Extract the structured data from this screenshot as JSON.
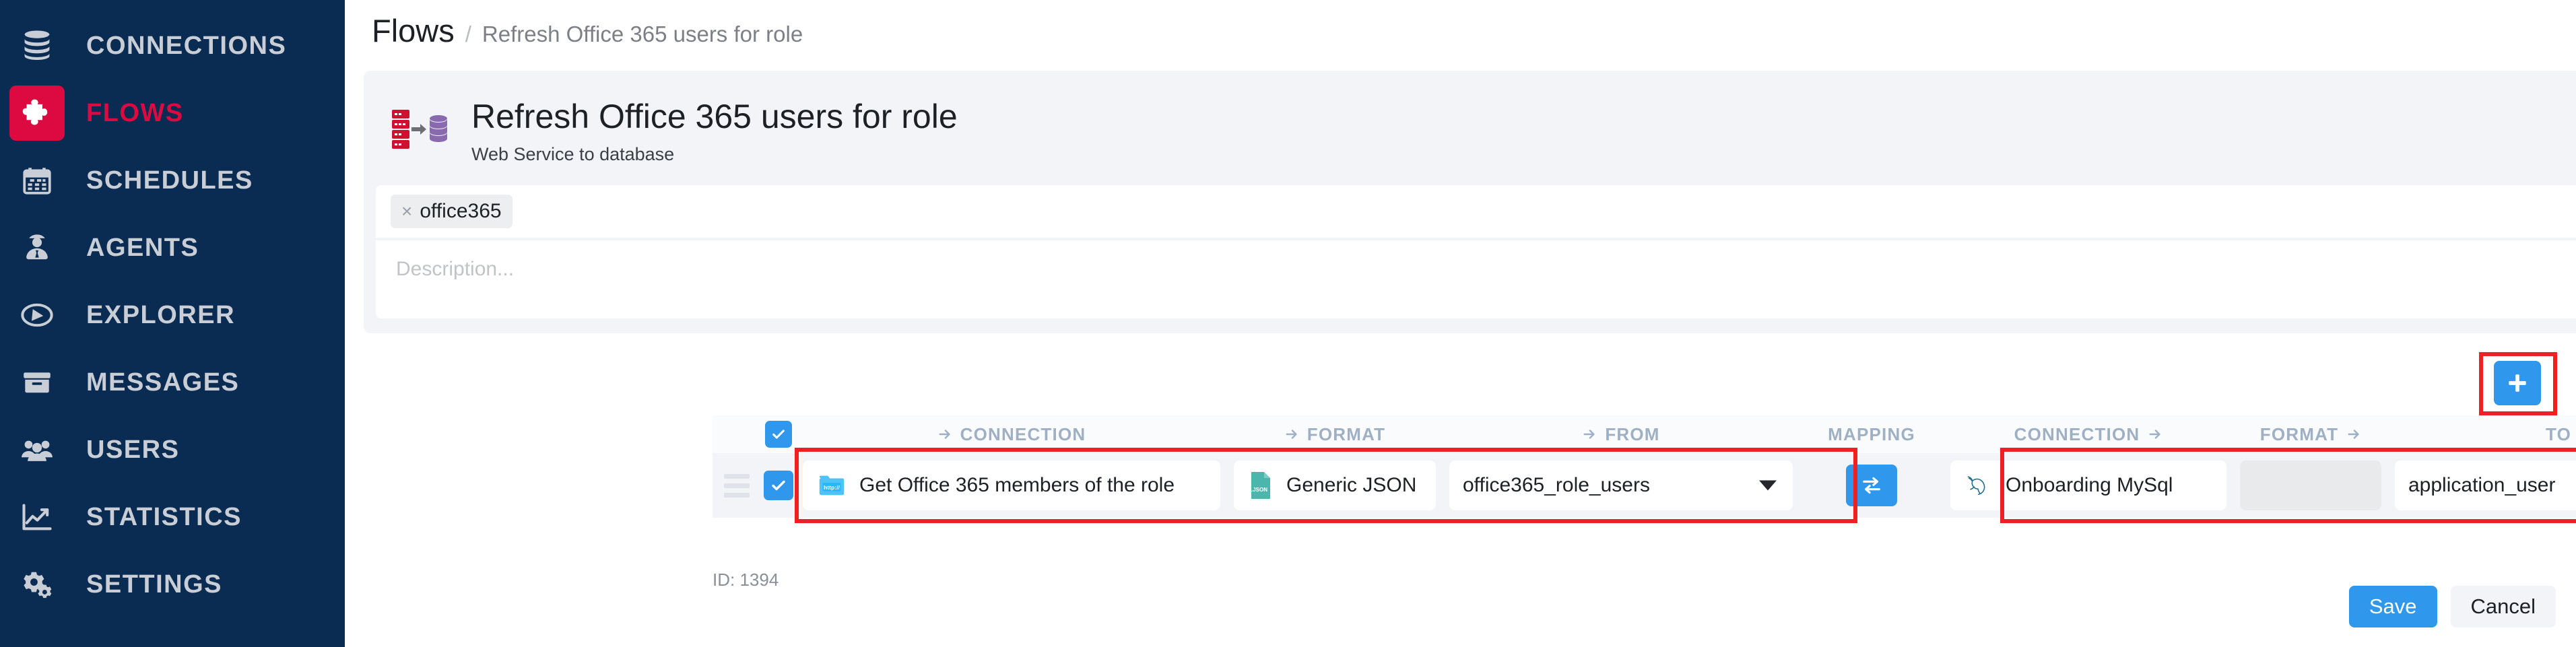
{
  "sidebar": {
    "items": [
      {
        "label": "CONNECTIONS",
        "icon": "database-stack-icon",
        "active": false
      },
      {
        "label": "FLOWS",
        "icon": "puzzle-piece-icon",
        "active": true
      },
      {
        "label": "SCHEDULES",
        "icon": "calendar-icon",
        "active": false
      },
      {
        "label": "AGENTS",
        "icon": "agent-icon",
        "active": false
      },
      {
        "label": "EXPLORER",
        "icon": "compass-icon",
        "active": false
      },
      {
        "label": "MESSAGES",
        "icon": "inbox-icon",
        "active": false
      },
      {
        "label": "USERS",
        "icon": "users-icon",
        "active": false
      },
      {
        "label": "STATISTICS",
        "icon": "line-chart-icon",
        "active": false
      },
      {
        "label": "SETTINGS",
        "icon": "gears-icon",
        "active": false
      }
    ],
    "background_color": "#0b2c52",
    "active_color": "#dc0a41"
  },
  "breadcrumb": {
    "root": "Flows",
    "separator": "/",
    "leaf": "Refresh Office 365 users for role"
  },
  "card": {
    "title": "Refresh Office 365 users for role",
    "subtitle": "Web Service to database",
    "flow_type_icon": "webservice-to-database-icon",
    "tags": {
      "chips": [
        {
          "label": "office365",
          "remove_icon": "close-icon"
        }
      ],
      "caret_icon": "chevron-down-icon"
    },
    "description": {
      "value": "",
      "placeholder": "Description..."
    }
  },
  "toolbar": {
    "add_label": "+",
    "add_icon": "plus-icon",
    "add_highlight_color": "#ee2024"
  },
  "table": {
    "headers": [
      {
        "label": "CONNECTION",
        "arrow": "left",
        "key": "connection_src"
      },
      {
        "label": "FORMAT",
        "arrow": "left",
        "key": "format_src"
      },
      {
        "label": "FROM",
        "arrow": "left",
        "key": "from"
      },
      {
        "label": "MAPPING",
        "arrow": "none",
        "key": "mapping"
      },
      {
        "label": "CONNECTION",
        "arrow": "right",
        "key": "connection_dst"
      },
      {
        "label": "FORMAT",
        "arrow": "right",
        "key": "format_dst"
      },
      {
        "label": "TO",
        "arrow": "right",
        "key": "to"
      }
    ],
    "select_all_checked": true,
    "rows": [
      {
        "checked": true,
        "drag_handle_icon": "drag-handle-icon",
        "connection_src": {
          "label": "Get Office 365 members of the role",
          "icon": "http-folder-icon"
        },
        "format_src": {
          "label": "Generic JSON",
          "icon": "json-file-icon"
        },
        "from": {
          "value": "office365_role_users",
          "caret_icon": "chevron-down-icon"
        },
        "mapping": {
          "icon": "swap-arrows-icon"
        },
        "connection_dst": {
          "label": "Onboarding MySql",
          "icon": "mysql-dolphin-icon"
        },
        "format_dst": {
          "value": ""
        },
        "to": {
          "value": "application_user",
          "caret_icon": "chevron-down-icon"
        },
        "actions": [
          {
            "name": "copy",
            "icon": "copy-icon"
          },
          {
            "name": "delete",
            "icon": "trash-icon"
          }
        ]
      }
    ],
    "highlights": [
      {
        "name": "source-section-highlight",
        "color": "#ee2024"
      },
      {
        "name": "destination-section-highlight",
        "color": "#ee2024"
      }
    ]
  },
  "footer": {
    "id_label": "ID: 1394",
    "save_label": "Save",
    "cancel_label": "Cancel"
  }
}
